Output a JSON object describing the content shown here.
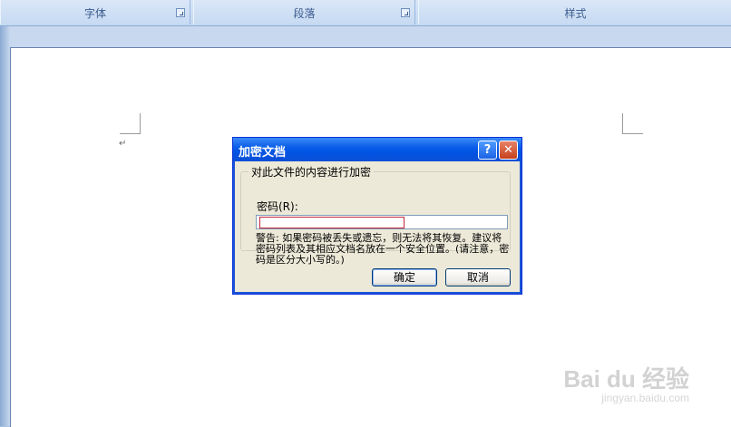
{
  "ribbon": {
    "groups": [
      {
        "label": "字体"
      },
      {
        "label": "段落"
      },
      {
        "label": "样式"
      }
    ]
  },
  "document": {
    "paragraph_mark": "↵"
  },
  "dialog": {
    "title": "加密文档",
    "help_glyph": "?",
    "close_glyph": "✕",
    "group_label": "对此文件的内容进行加密",
    "password_label": "密码(R):",
    "password_value": "",
    "warning": "警告: 如果密码被丢失或遗忘，则无法将其恢复。建议将密码列表及其相应文档名放在一个安全位置。(请注意，密码是区分大小写的。)",
    "ok_label": "确定",
    "cancel_label": "取消"
  },
  "watermark": {
    "logo_text": "Bai du 经验",
    "url": "jingyan.baidu.com"
  }
}
